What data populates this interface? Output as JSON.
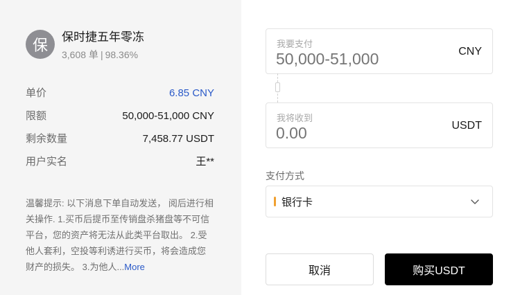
{
  "merchant": {
    "avatar_char": "保",
    "name": "保时捷五年零冻",
    "orders": "3,608 单",
    "separator": "|",
    "completion_rate": "98.36%"
  },
  "details": {
    "price_label": "单价",
    "price_value": "6.85 CNY",
    "limit_label": "限额",
    "limit_value": "50,000-51,000 CNY",
    "remaining_label": "剩余数量",
    "remaining_value": "7,458.77 USDT",
    "realname_label": "用户实名",
    "realname_value": "王**"
  },
  "notice": {
    "text": "温馨提示: 以下消息下单自动发送， 阅后进行相关操作. 1.买币后提币至传销盘杀猪盘等不可信平台，您的资产将无法从此类平台取出。 2.受他人套利，空投等利诱进行买币，将会造成您 财产的损失。 3.为他人...",
    "more": "More"
  },
  "pay_field": {
    "label": "我要支付",
    "placeholder": "50,000-51,000",
    "currency": "CNY"
  },
  "receive_field": {
    "label": "我将收到",
    "placeholder": "0.00",
    "currency": "USDT"
  },
  "payment_method": {
    "label": "支付方式",
    "selected": "银行卡",
    "accent_color": "#f0a030"
  },
  "buttons": {
    "cancel": "取消",
    "buy": "购买USDT"
  },
  "icons": {
    "dropdown": "chevron-down-icon"
  }
}
